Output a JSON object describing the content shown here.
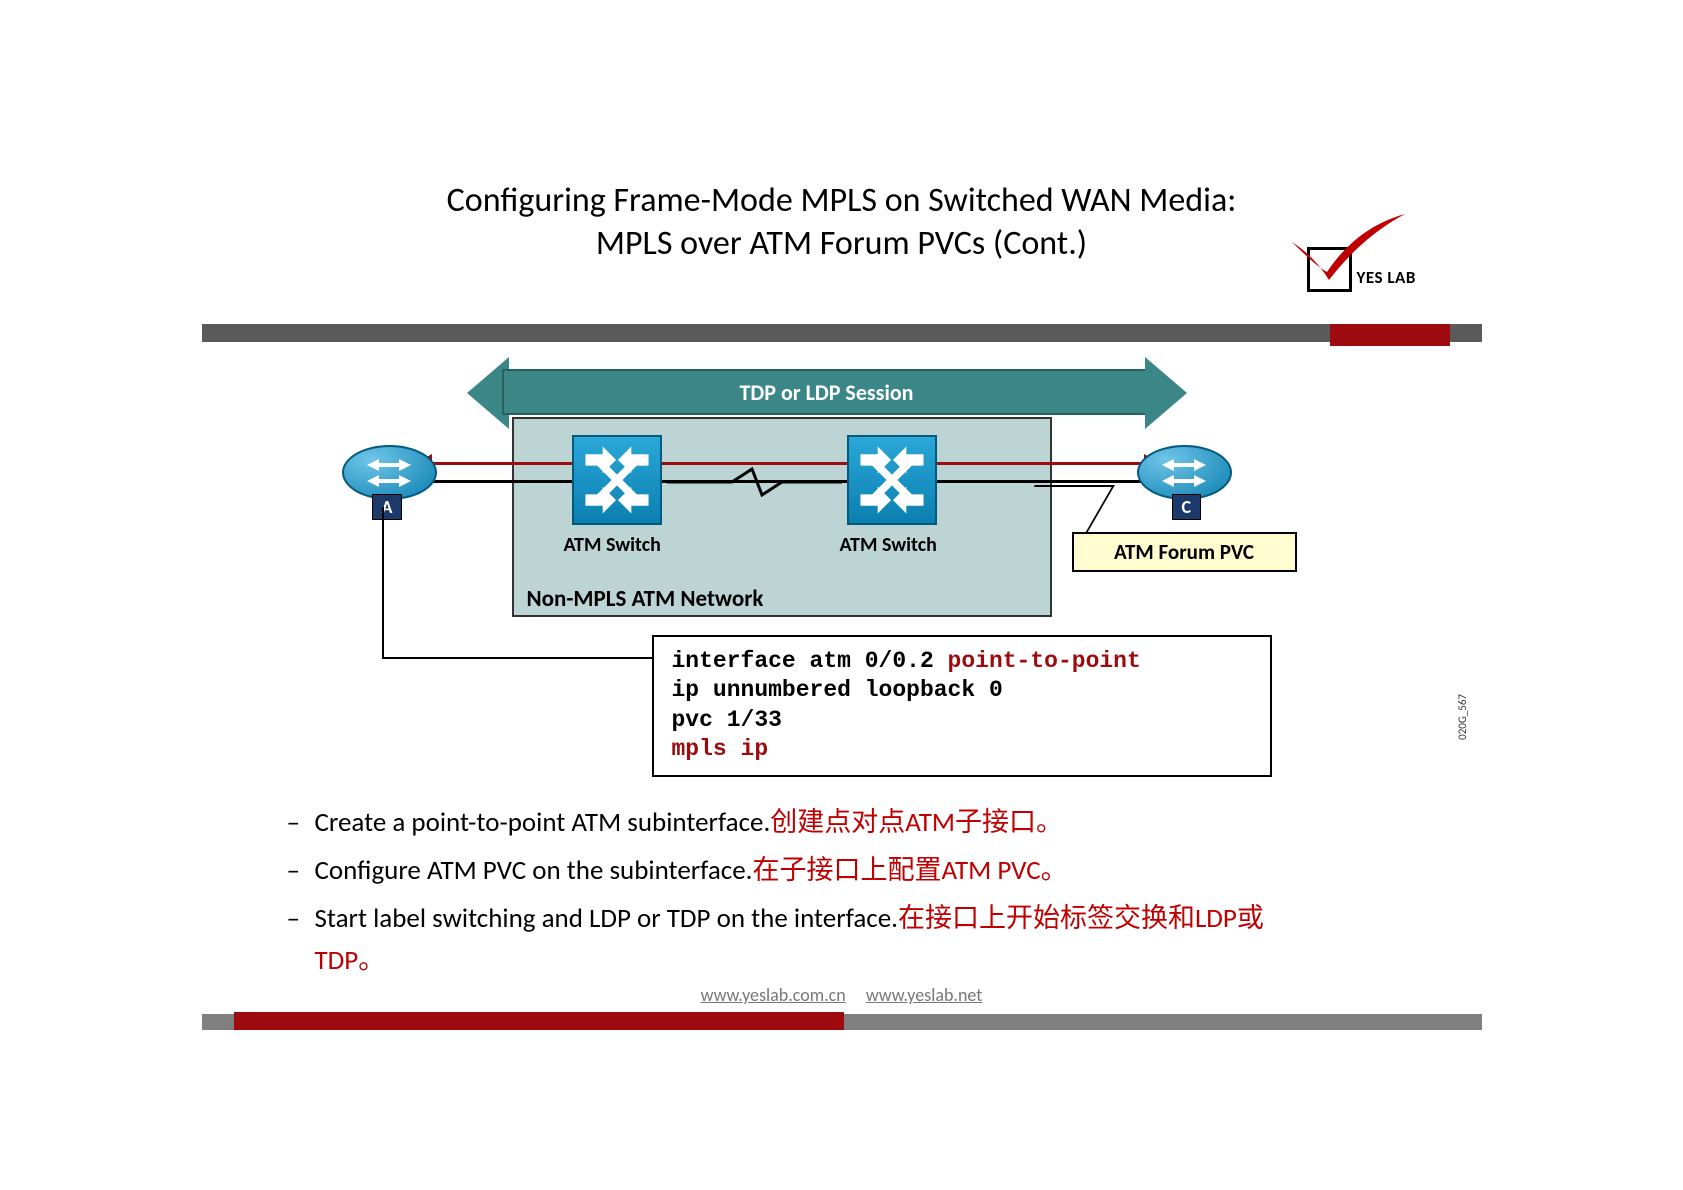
{
  "title_line1": "Configuring Frame-Mode MPLS on Switched WAN Media:",
  "title_line2": "MPLS over ATM Forum PVCs (Cont.)",
  "logo_text": "YES LAB",
  "diagram": {
    "session_label": "TDP or LDP Session",
    "router_a": "A",
    "router_c": "C",
    "switch_label": "ATM Switch",
    "network_label": "Non-MPLS ATM Network",
    "pvc_label": "ATM Forum PVC",
    "image_id": "020G_567"
  },
  "code": {
    "l1a": "interface atm 0/0.2 ",
    "l1b": "point-to-point",
    "l2": " ip unnumbered loopback 0",
    "l3": " pvc 1/33",
    "l4": " mpls ip"
  },
  "bullets": [
    {
      "en": "Create a point-to-point ATM subinterface.",
      "zh": "创建点对点ATM子接口。"
    },
    {
      "en": "Configure ATM PVC on the subinterface.",
      "zh": "在子接口上配置ATM PVC。"
    },
    {
      "en": "Start label switching and LDP or TDP on the interface.",
      "zh": "在接口上开始标签交换和LDP或TDP。"
    }
  ],
  "footer": {
    "url1": "www.yeslab.com.cn",
    "url2": "www.yeslab.net"
  }
}
